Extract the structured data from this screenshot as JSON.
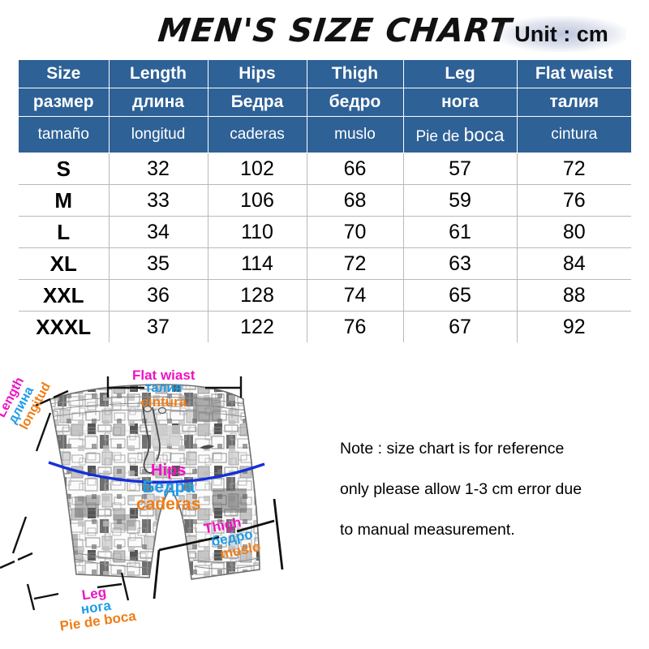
{
  "title": "MEN'S SIZE CHART",
  "unit": "Unit : cm",
  "table": {
    "header_rows": [
      [
        "Size",
        "Length",
        "Hips",
        "Thigh",
        "Leg",
        "Flat waist"
      ],
      [
        "размер",
        "длина",
        "Бедра",
        "бедро",
        "нога",
        "талия"
      ],
      [
        "tamaño",
        "longitud",
        "caderas",
        "muslo",
        "Pie de boca",
        "cintura"
      ]
    ],
    "header_leg_es_prefix": "Pie de ",
    "header_leg_es_suffix": "boca",
    "rows": [
      {
        "size": "S",
        "length": "32",
        "hips": "102",
        "thigh": "66",
        "leg": "57",
        "flat_waist": "72"
      },
      {
        "size": "M",
        "length": "33",
        "hips": "106",
        "thigh": "68",
        "leg": "59",
        "flat_waist": "76"
      },
      {
        "size": "L",
        "length": "34",
        "hips": "110",
        "thigh": "70",
        "leg": "61",
        "flat_waist": "80"
      },
      {
        "size": "XL",
        "length": "35",
        "hips": "114",
        "thigh": "72",
        "leg": "63",
        "flat_waist": "84"
      },
      {
        "size": "XXL",
        "length": "36",
        "hips": "128",
        "thigh": "74",
        "leg": "65",
        "flat_waist": "88"
      },
      {
        "size": "XXXL",
        "length": "37",
        "hips": "122",
        "thigh": "76",
        "leg": "67",
        "flat_waist": "92"
      }
    ]
  },
  "diagram": {
    "waist": {
      "en": "Flat wiast",
      "ru": "талия",
      "es": "cintura"
    },
    "length": {
      "en": "Length",
      "ru": "длина",
      "es": "longitud"
    },
    "hips": {
      "en": "Hips",
      "ru": "Бедра",
      "es": "caderas"
    },
    "thigh": {
      "en": "Thigh",
      "ru": "бедро",
      "es": "muslo"
    },
    "leg": {
      "en": "Leg",
      "ru": "нога",
      "es": "Pie de boca"
    }
  },
  "note": {
    "line1": "Note : size chart is for reference",
    "line2": "only please allow 1-3 cm error due",
    "line3": "to manual measurement."
  },
  "colors": {
    "header_blue": "#2e6196",
    "english_label": "#ee13c2",
    "russian_label": "#1e9be8",
    "spanish_label": "#f07d15",
    "hips_line": "#1430d8",
    "grid": "#b9b9b9"
  }
}
